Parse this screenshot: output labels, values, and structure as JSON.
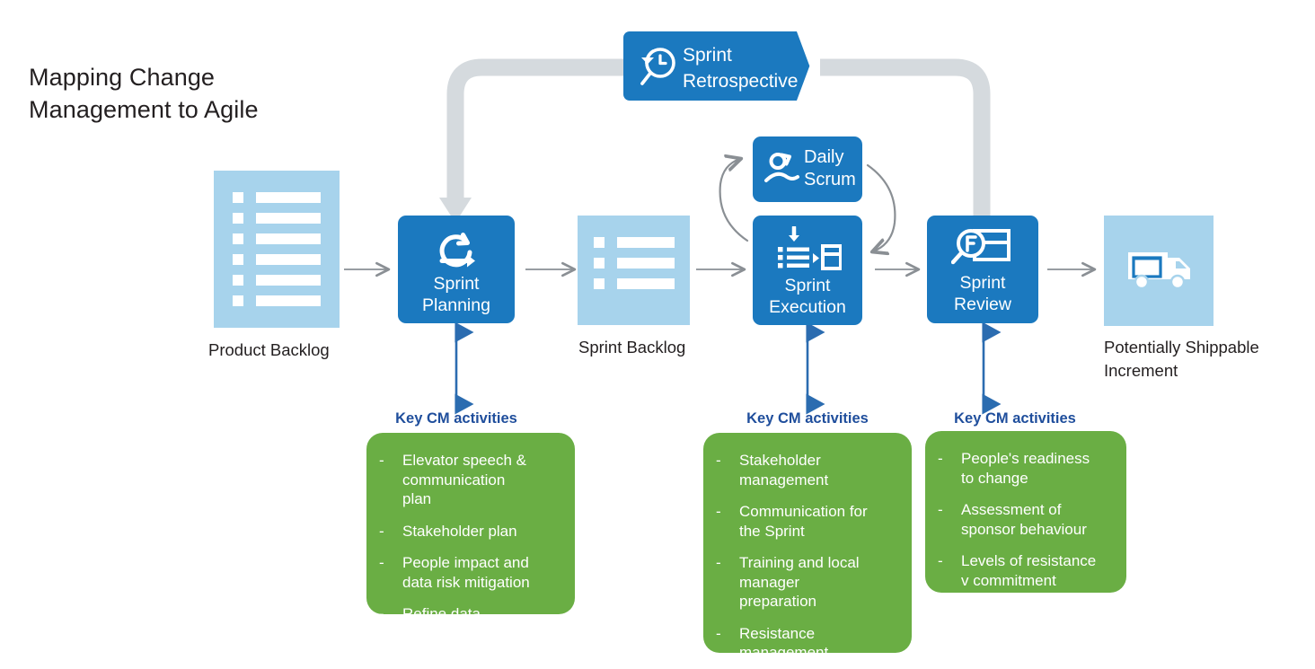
{
  "title": "Mapping Change\nManagement to Agile",
  "colors": {
    "blue": "#1b79bf",
    "light_blue": "#a7d3ec",
    "green": "#6aae44",
    "gray_path": "#d5dade",
    "arrow_gray": "#8a8f94",
    "heading_blue": "#1f4e9c",
    "text_dark": "#231f20"
  },
  "artifacts": [
    {
      "name": "product-backlog",
      "caption": "Product Backlog",
      "rows": 6,
      "icon": "list-document-icon"
    },
    {
      "name": "sprint-backlog",
      "caption": "Sprint Backlog",
      "rows": 3,
      "icon": "list-document-icon"
    },
    {
      "name": "potentially-shippable-increment",
      "caption": "Potentially Shippable\nIncrement",
      "rows": 0,
      "icon": "delivery-truck-icon"
    }
  ],
  "processes": [
    {
      "name": "sprint-planning",
      "label": "Sprint\nPlanning",
      "icon": "refresh-cycle-arrow-icon"
    },
    {
      "name": "sprint-execution",
      "label": "Sprint\nExecution",
      "icon": "list-to-board-icon"
    },
    {
      "name": "sprint-review",
      "label": "Sprint\nReview",
      "icon": "magnifier-board-icon"
    },
    {
      "name": "daily-scrum",
      "label": "Daily\nScrum",
      "icon": "person-cycle-icon"
    }
  ],
  "retrospective": {
    "label": "Sprint\nRetrospective",
    "icon": "clock-rewind-icon"
  },
  "cm_sections": [
    {
      "heading": "Key CM activities",
      "items": [
        "Elevator speech &\ncommunication\nplan",
        "Stakeholder plan",
        "People impact and\ndata risk mitigation",
        "Refine data"
      ]
    },
    {
      "heading": "Key CM activities",
      "items": [
        "Stakeholder\nmanagement",
        "Communication for\nthe Sprint",
        "Training and local\nmanager\npreparation",
        "Resistance\nmanagement"
      ]
    },
    {
      "heading": "Key CM activities",
      "items": [
        "People's readiness\nto change",
        "Assessment of\nsponsor behaviour",
        "Levels of resistance\nv commitment"
      ]
    }
  ],
  "bullet_marker": "-"
}
